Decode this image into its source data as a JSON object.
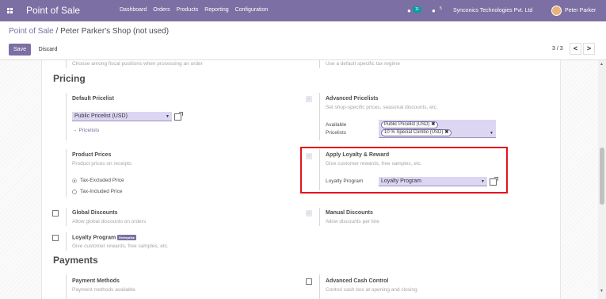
{
  "navbar": {
    "app_title": "Point of Sale",
    "menu": [
      "Dashboard",
      "Orders",
      "Products",
      "Reporting",
      "Configuration"
    ],
    "chat_badge": "11",
    "activity_count": "5",
    "company": "Synconics Technologies Pvt. Ltd",
    "user": "Peter Parker"
  },
  "control_panel": {
    "breadcrumb_root": "Point of Sale",
    "breadcrumb_sep": " / ",
    "breadcrumb_current": "Peter Parker's Shop (not used)",
    "save_label": "Save",
    "discard_label": "Discard",
    "pager": "3 / 3",
    "prev": "<",
    "next": ">"
  },
  "top_cut": {
    "left_desc": "Choose among fiscal positions when processing an order",
    "right_desc": "Use a default specific tax regime"
  },
  "pricing": {
    "title": "Pricing",
    "default_pricelist": {
      "label": "Default Pricelist",
      "value": "Public Pricelist (USD)",
      "link": "Pricelists"
    },
    "advanced_pricelists": {
      "label": "Advanced Pricelists",
      "desc": "Set shop-specific prices, seasonal discounts, etc.",
      "available_label": "Available Pricelists",
      "tags": [
        "Public Pricelist (USD)",
        "10 % Special Combo (USD)"
      ]
    },
    "product_prices": {
      "label": "Product Prices",
      "desc": "Product prices on receipts",
      "options": [
        "Tax-Excluded Price",
        "Tax-Included Price"
      ],
      "selected": "Tax-Excluded Price"
    },
    "loyalty": {
      "label": "Apply Loyalty & Reward",
      "desc": "Give customer rewards, free samples, etc.",
      "program_label": "Loyalty Program",
      "program_value": "Loyalty Program"
    },
    "global_discounts": {
      "label": "Global Discounts",
      "desc": "Allow global discounts on orders"
    },
    "manual_discounts": {
      "label": "Manual Discounts",
      "desc": "Allow discounts per line"
    },
    "loyalty_program": {
      "label": "Loyalty Program",
      "badge": "Enterprise",
      "desc": "Give customer rewards, free samples, etc."
    }
  },
  "payments": {
    "title": "Payments",
    "payment_methods": {
      "label": "Payment Methods",
      "desc": "Payment methods available"
    },
    "cash_control": {
      "label": "Advanced Cash Control",
      "desc": "Control cash box at opening and closing"
    }
  },
  "colors": {
    "brand": "#7c6fa3",
    "highlight": "#e3151d"
  }
}
